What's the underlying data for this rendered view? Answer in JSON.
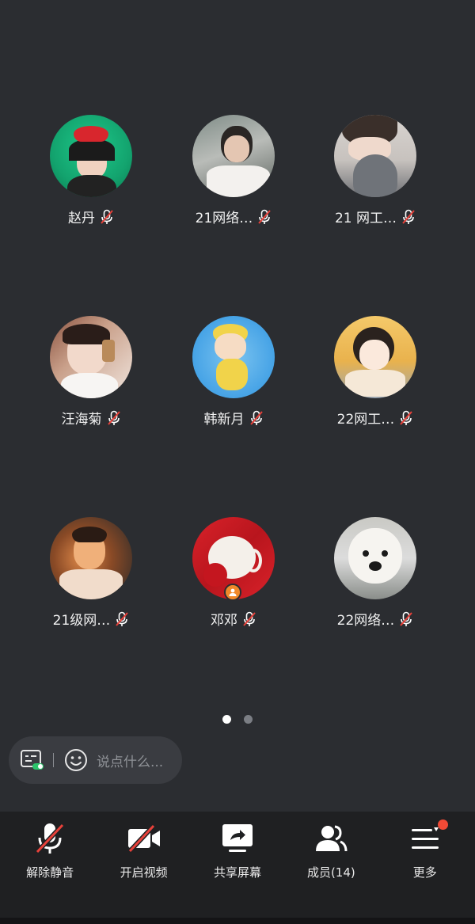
{
  "participants": [
    {
      "name": "赵丹",
      "avatar_colors": [
        "#1ec98a",
        "#0a7a50"
      ]
    },
    {
      "name": "21网络…",
      "avatar_colors": [
        "#b9bcb8",
        "#5b625d"
      ]
    },
    {
      "name": "21 网工…",
      "avatar_colors": [
        "#d9d4d0",
        "#6d6f74"
      ]
    },
    {
      "name": "汪海菊",
      "avatar_colors": [
        "#f1e6df",
        "#8a5240"
      ]
    },
    {
      "name": "韩新月",
      "avatar_colors": [
        "#46a3e6",
        "#f1d34a"
      ]
    },
    {
      "name": "22网工…",
      "avatar_colors": [
        "#f4c96a",
        "#9aa6b3"
      ]
    },
    {
      "name": "21级网…",
      "avatar_colors": [
        "#e08a4a",
        "#2a2a2a"
      ]
    },
    {
      "name": "邓邓",
      "avatar_colors": [
        "#d9222a",
        "#f4f0ea"
      ]
    },
    {
      "name": "22网络…",
      "avatar_colors": [
        "#dcdcdc",
        "#8a8e8a"
      ]
    }
  ],
  "pager": {
    "pages": 2,
    "current": 1
  },
  "chat": {
    "placeholder": "说点什么..."
  },
  "toolbar": {
    "unmute": "解除静音",
    "video": "开启视频",
    "share": "共享屏幕",
    "members": "成员(14)",
    "more": "更多"
  },
  "colors": {
    "background": "#2b2d31",
    "toolbar": "#1f2022",
    "mute_slash": "#e8413a",
    "host_badge": "#f0892a",
    "notification": "#f04a36"
  }
}
